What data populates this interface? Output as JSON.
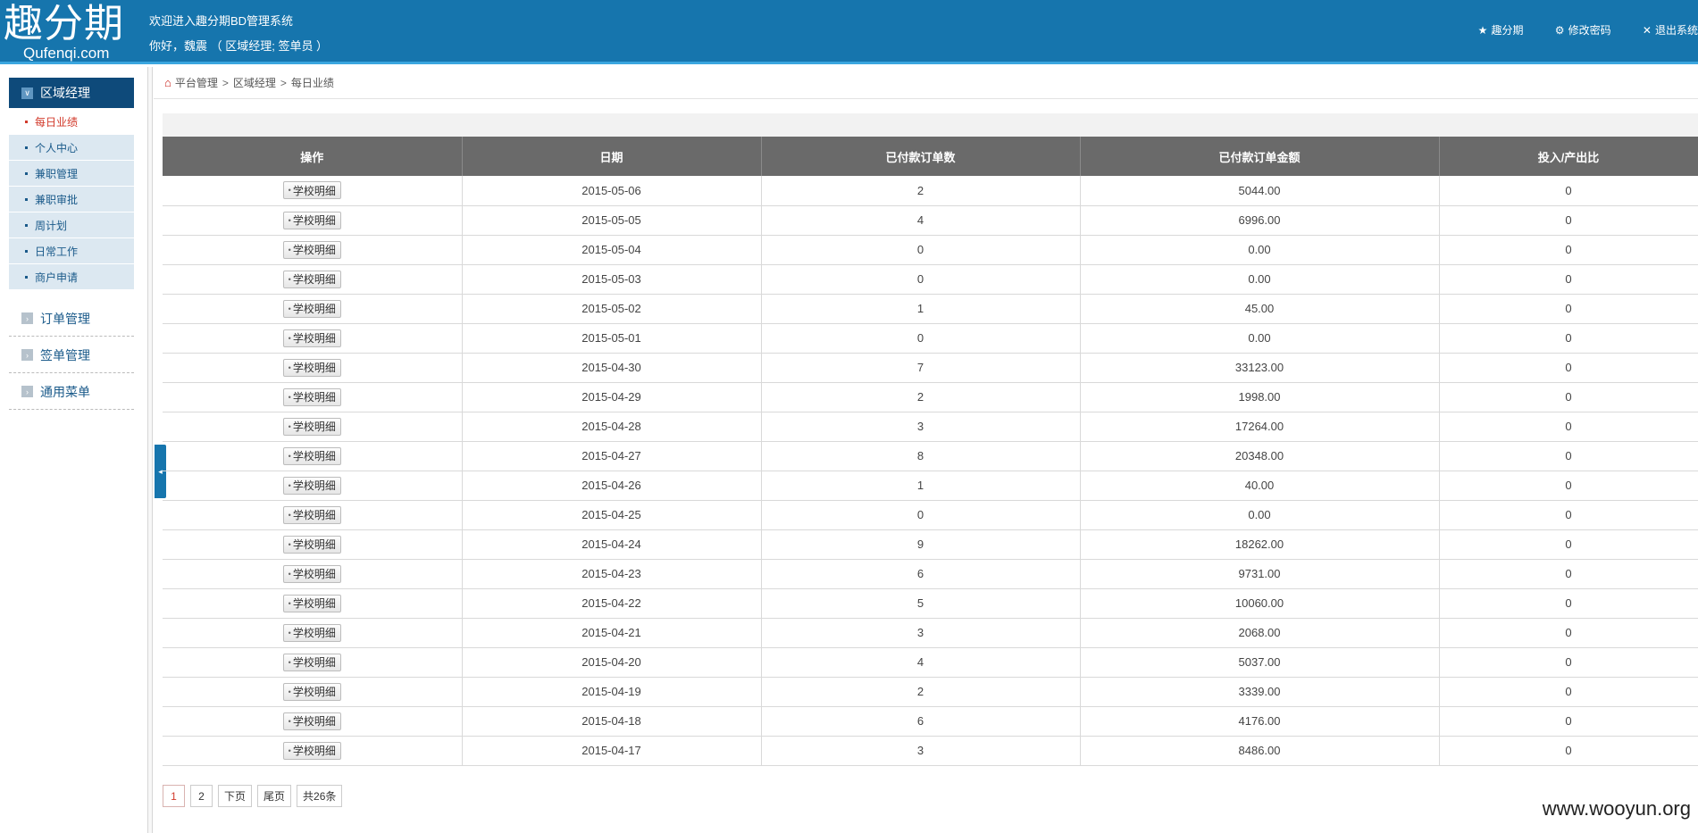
{
  "header": {
    "logo_main": "趣分期",
    "logo_sub": "Qufenqi.com",
    "welcome": "欢迎进入趣分期BD管理系统",
    "greeting": "你好，魏震 （ 区域经理; 签单员 ）",
    "links": [
      {
        "icon": "★",
        "label": "趣分期"
      },
      {
        "icon": "⚙",
        "label": "修改密码"
      },
      {
        "icon": "✕",
        "label": "退出系统"
      }
    ]
  },
  "sidebar": {
    "section_title": "区域经理",
    "section_icon": "∨",
    "items": [
      {
        "label": "每日业绩"
      },
      {
        "label": "个人中心"
      },
      {
        "label": "兼职管理"
      },
      {
        "label": "兼职审批"
      },
      {
        "label": "周计划"
      },
      {
        "label": "日常工作"
      },
      {
        "label": "商户申请"
      }
    ],
    "groups": [
      {
        "label": "订单管理"
      },
      {
        "label": "签单管理"
      },
      {
        "label": "通用菜单"
      }
    ],
    "group_icon": "›",
    "collapse_icon": "◂"
  },
  "breadcrumb": {
    "home_icon": "⌂",
    "items": [
      "平台管理",
      "区域经理",
      "每日业绩"
    ],
    "separator": ">"
  },
  "table": {
    "columns": [
      "操作",
      "日期",
      "已付款订单数",
      "已付款订单金额",
      "投入/产出比"
    ],
    "action_label": "学校明细",
    "action_icon": "•",
    "rows": [
      [
        "2015-05-06",
        "2",
        "5044.00",
        "0"
      ],
      [
        "2015-05-05",
        "4",
        "6996.00",
        "0"
      ],
      [
        "2015-05-04",
        "0",
        "0.00",
        "0"
      ],
      [
        "2015-05-03",
        "0",
        "0.00",
        "0"
      ],
      [
        "2015-05-02",
        "1",
        "45.00",
        "0"
      ],
      [
        "2015-05-01",
        "0",
        "0.00",
        "0"
      ],
      [
        "2015-04-30",
        "7",
        "33123.00",
        "0"
      ],
      [
        "2015-04-29",
        "2",
        "1998.00",
        "0"
      ],
      [
        "2015-04-28",
        "3",
        "17264.00",
        "0"
      ],
      [
        "2015-04-27",
        "8",
        "20348.00",
        "0"
      ],
      [
        "2015-04-26",
        "1",
        "40.00",
        "0"
      ],
      [
        "2015-04-25",
        "0",
        "0.00",
        "0"
      ],
      [
        "2015-04-24",
        "9",
        "18262.00",
        "0"
      ],
      [
        "2015-04-23",
        "6",
        "9731.00",
        "0"
      ],
      [
        "2015-04-22",
        "5",
        "10060.00",
        "0"
      ],
      [
        "2015-04-21",
        "3",
        "2068.00",
        "0"
      ],
      [
        "2015-04-20",
        "4",
        "5037.00",
        "0"
      ],
      [
        "2015-04-19",
        "2",
        "3339.00",
        "0"
      ],
      [
        "2015-04-18",
        "6",
        "4176.00",
        "0"
      ],
      [
        "2015-04-17",
        "3",
        "8486.00",
        "0"
      ]
    ]
  },
  "pager": {
    "pages": [
      "1",
      "2"
    ],
    "current": "1",
    "next": "下页",
    "last": "尾页",
    "total": "共26条"
  },
  "watermark": "www.wooyun.org",
  "colors": {
    "header_bg": "#1675ad",
    "nav_active_bg": "#0e4a7a",
    "table_header_bg": "#6a6a6a",
    "active_red": "#d23a2b"
  }
}
